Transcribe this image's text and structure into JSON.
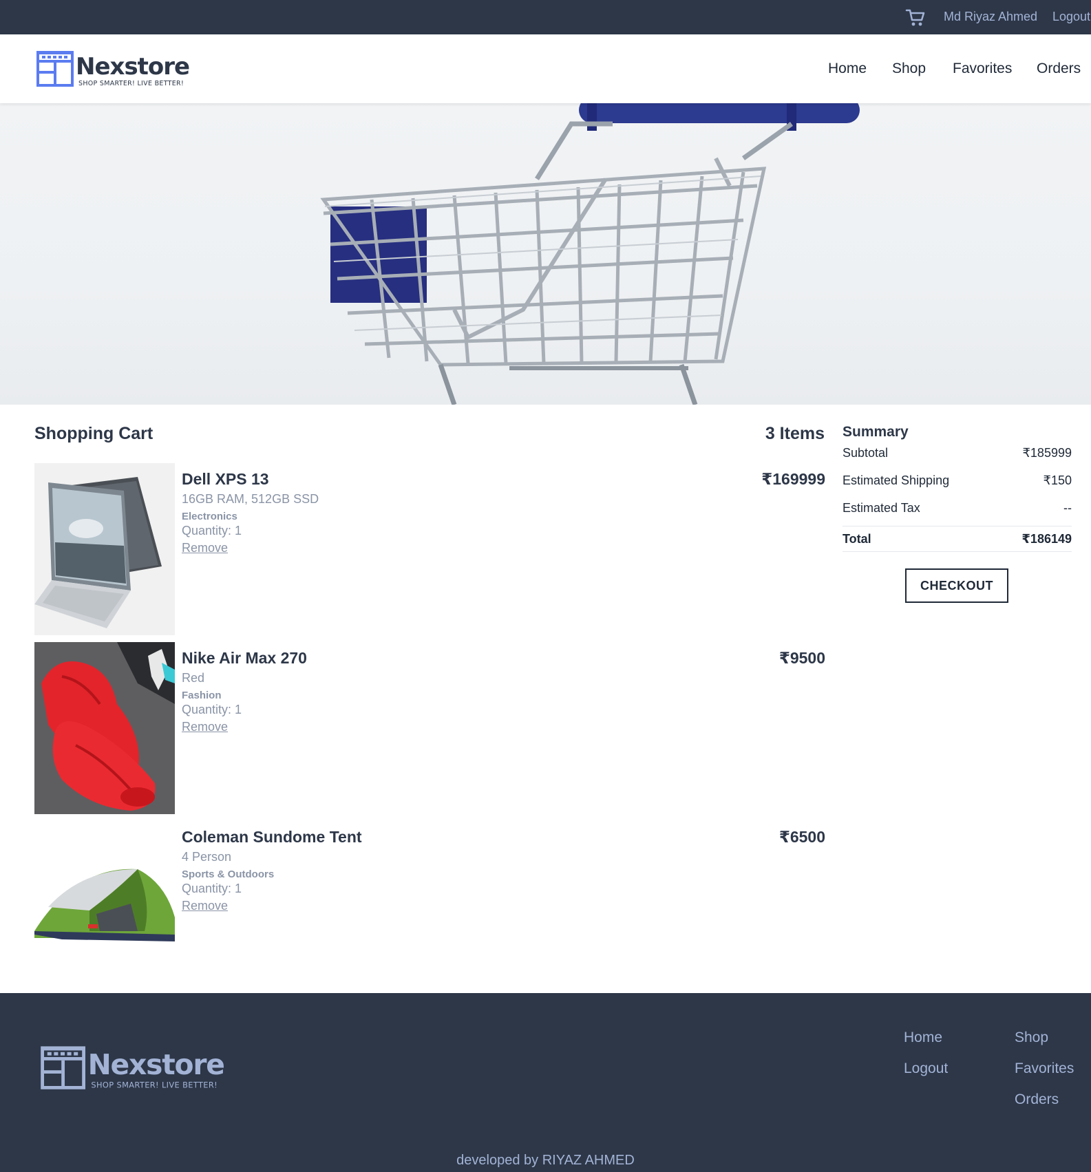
{
  "topbar": {
    "user_name": "Md Riyaz Ahmed",
    "logout": "Logout",
    "cart_icon": "cart-icon"
  },
  "brand": {
    "name": "Nexstore",
    "tagline": "SHOP SMARTER! LIVE BETTER!",
    "color": "#2d3748",
    "accent": "#5b7cf0"
  },
  "nav": {
    "home": "Home",
    "shop": "Shop",
    "favorites": "Favorites",
    "orders": "Orders"
  },
  "cart": {
    "title": "Shopping Cart",
    "count": "3 Items",
    "items": [
      {
        "name": "Dell XPS 13",
        "variant": "16GB RAM, 512GB SSD",
        "category": "Electronics",
        "quantity": "Quantity: 1",
        "remove": "Remove",
        "price": "₹169999"
      },
      {
        "name": "Nike Air Max 270",
        "variant": "Red",
        "category": "Fashion",
        "quantity": "Quantity: 1",
        "remove": "Remove",
        "price": "₹9500"
      },
      {
        "name": "Coleman Sundome Tent",
        "variant": "4 Person",
        "category": "Sports & Outdoors",
        "quantity": "Quantity: 1",
        "remove": "Remove",
        "price": "₹6500"
      }
    ]
  },
  "summary": {
    "title": "Summary",
    "subtotal_label": "Subtotal",
    "subtotal_value": "₹185999",
    "shipping_label": "Estimated Shipping",
    "shipping_value": "₹150",
    "tax_label": "Estimated Tax",
    "tax_value": "--",
    "total_label": "Total",
    "total_value": "₹186149",
    "checkout": "CHECKOUT"
  },
  "footer": {
    "home": "Home",
    "shop": "Shop",
    "logout": "Logout",
    "favorites": "Favorites",
    "orders": "Orders",
    "credit": "developed by RIYAZ AHMED"
  }
}
